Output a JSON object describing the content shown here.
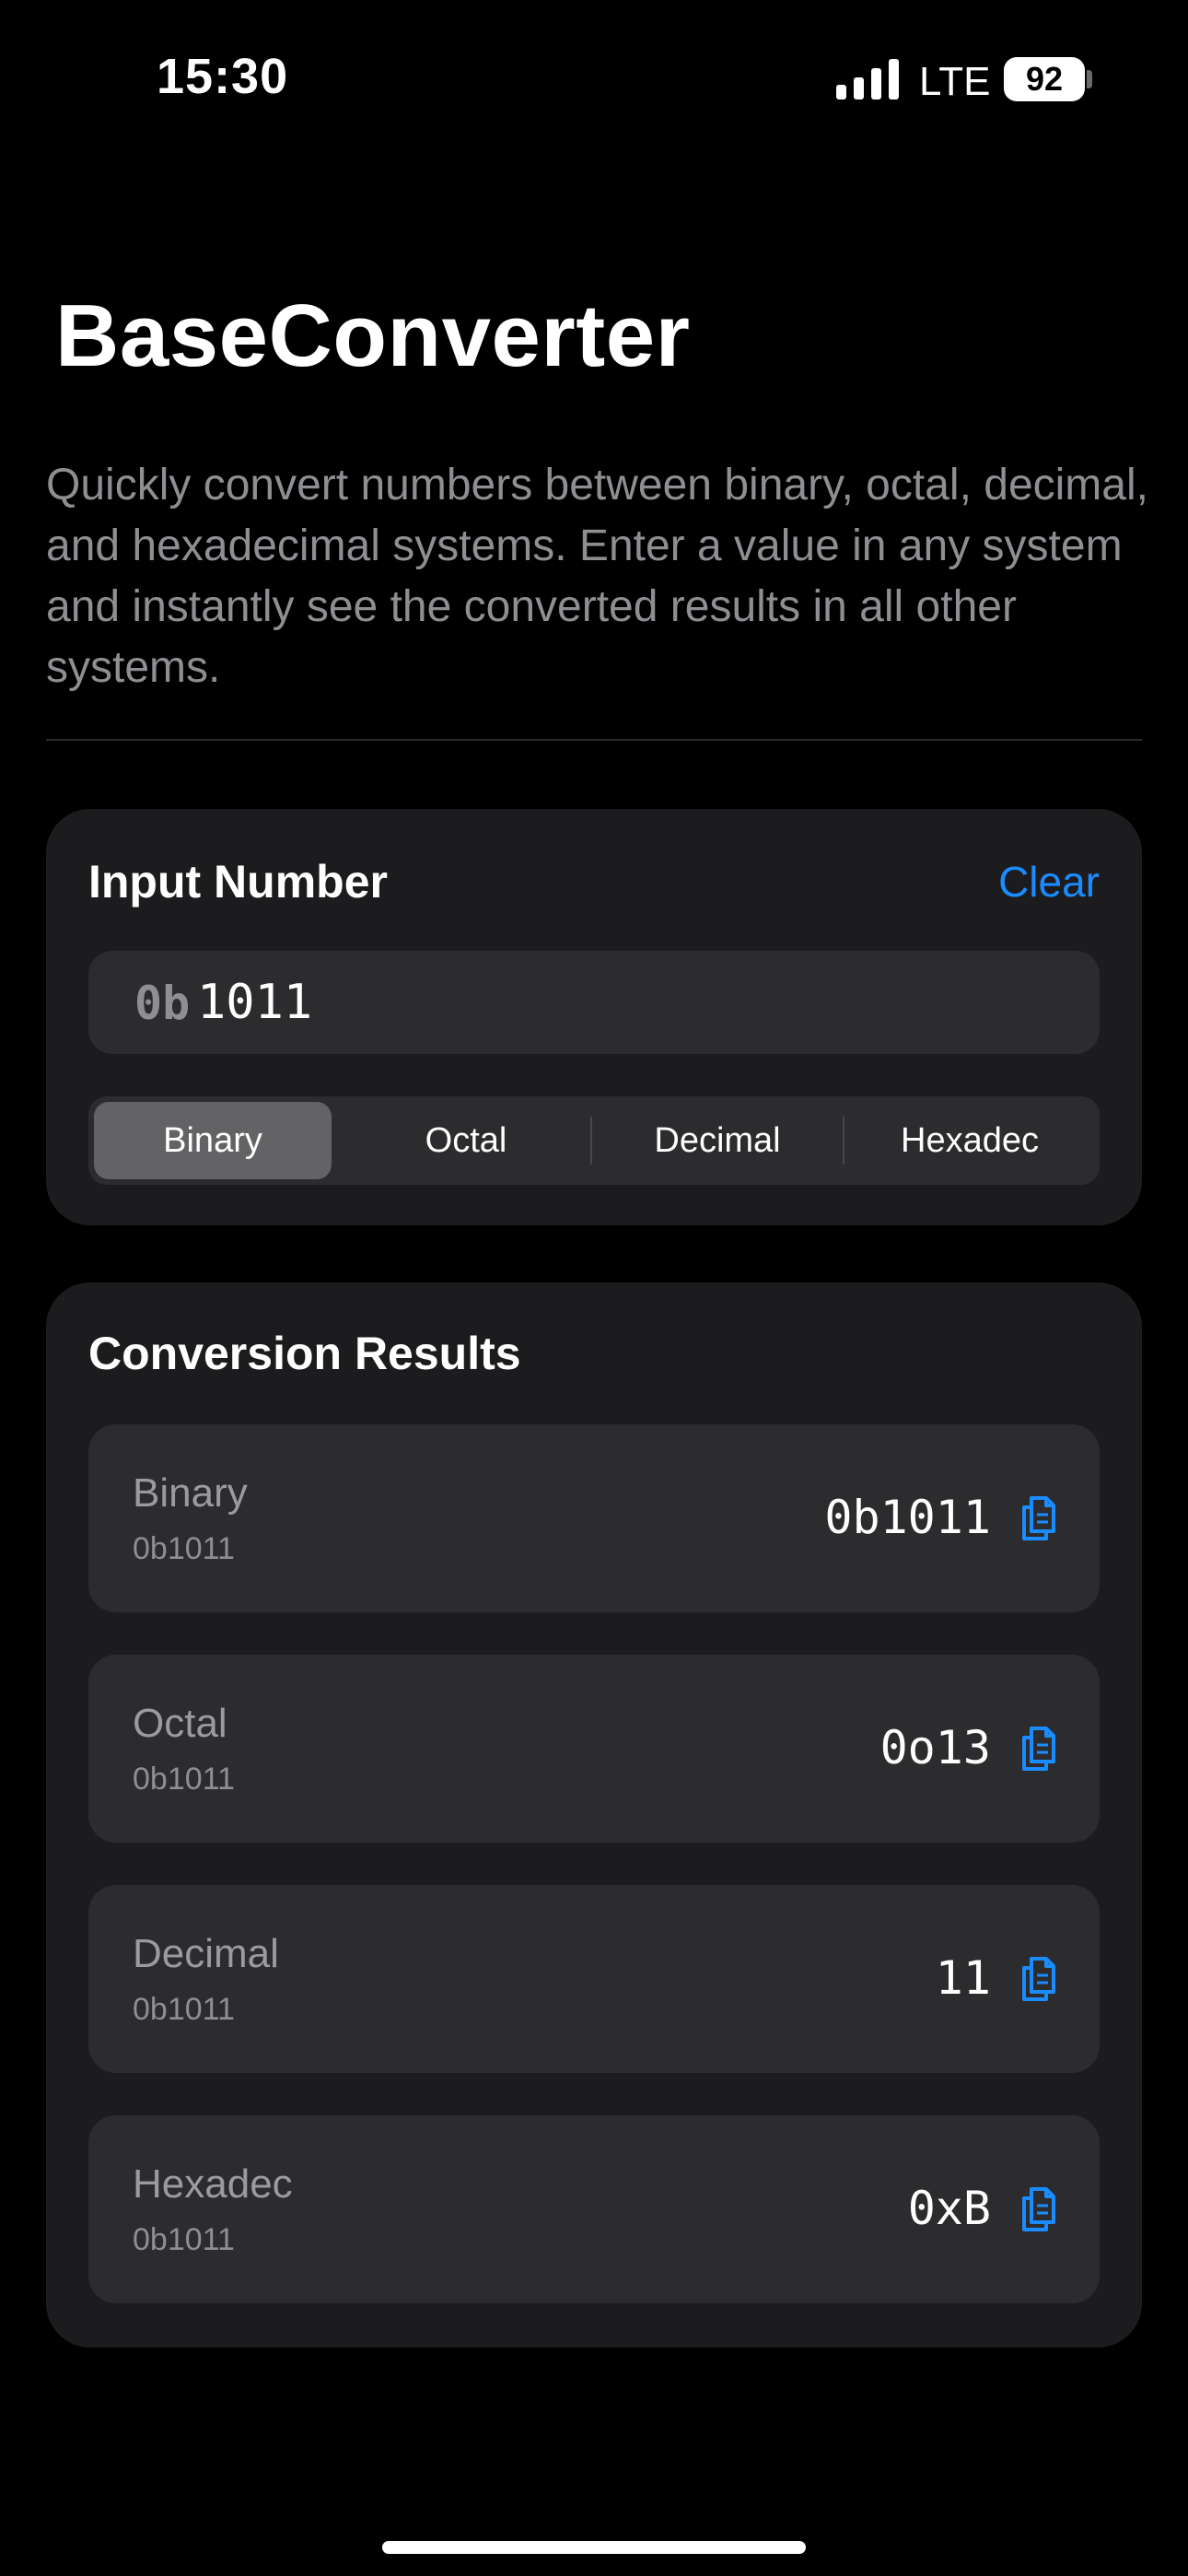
{
  "status_bar": {
    "time": "15:30",
    "network": "LTE",
    "battery": "92"
  },
  "header": {
    "title": "BaseConverter",
    "description": "Quickly convert numbers between binary, octal, decimal, and hexadecimal systems. Enter a value in any system and instantly see the converted results in all other systems."
  },
  "input_card": {
    "title": "Input Number",
    "clear_label": "Clear",
    "prefix": "0b",
    "value": "1011",
    "segments": [
      {
        "label": "Binary",
        "selected": true
      },
      {
        "label": "Octal",
        "selected": false
      },
      {
        "label": "Decimal",
        "selected": false
      },
      {
        "label": "Hexadec",
        "selected": false
      }
    ]
  },
  "results_card": {
    "title": "Conversion Results",
    "rows": [
      {
        "name": "Binary",
        "source": "0b1011",
        "value": "0b1011",
        "icon": "copy-icon"
      },
      {
        "name": "Octal",
        "source": "0b1011",
        "value": "0o13",
        "icon": "copy-icon"
      },
      {
        "name": "Decimal",
        "source": "0b1011",
        "value": "11",
        "icon": "copy-icon"
      },
      {
        "name": "Hexadec",
        "source": "0b1011",
        "value": "0xB",
        "icon": "copy-icon"
      }
    ]
  },
  "colors": {
    "background": "#000000",
    "card": "#1c1c1e",
    "field": "#2c2c2e",
    "accent": "#1a8cff",
    "secondary_text": "#8e8e93"
  }
}
